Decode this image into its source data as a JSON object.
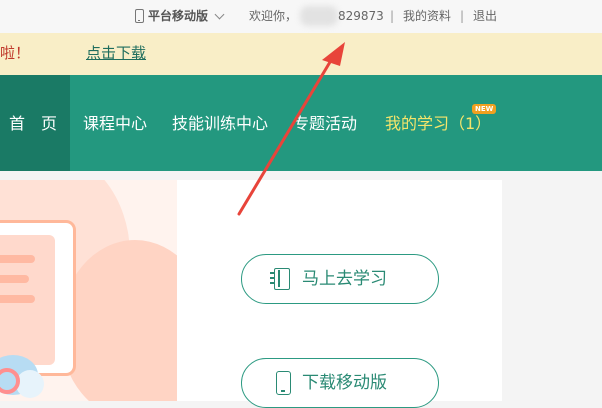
{
  "topbar": {
    "mobile_label": "平台移动版",
    "welcome": "欢迎你，",
    "user_id": "829873",
    "separator": "|",
    "profile": "我的资料",
    "logout": "退出"
  },
  "notice": {
    "text": "啦！",
    "link": "点击下载"
  },
  "nav": {
    "home": "首　页",
    "course": "课程中心",
    "skill": "技能训练中心",
    "topic": "专题活动",
    "mine": "我的学习（1）",
    "badge": "NEW"
  },
  "buttons": {
    "study": "马上去学习",
    "download": "下载移动版"
  },
  "colors": {
    "nav_bg": "#23987f",
    "nav_active_bg": "#1a7a65",
    "notice_bg": "#f9eec7",
    "accent": "#2a8a74",
    "annotation_arrow": "#e8443a"
  }
}
